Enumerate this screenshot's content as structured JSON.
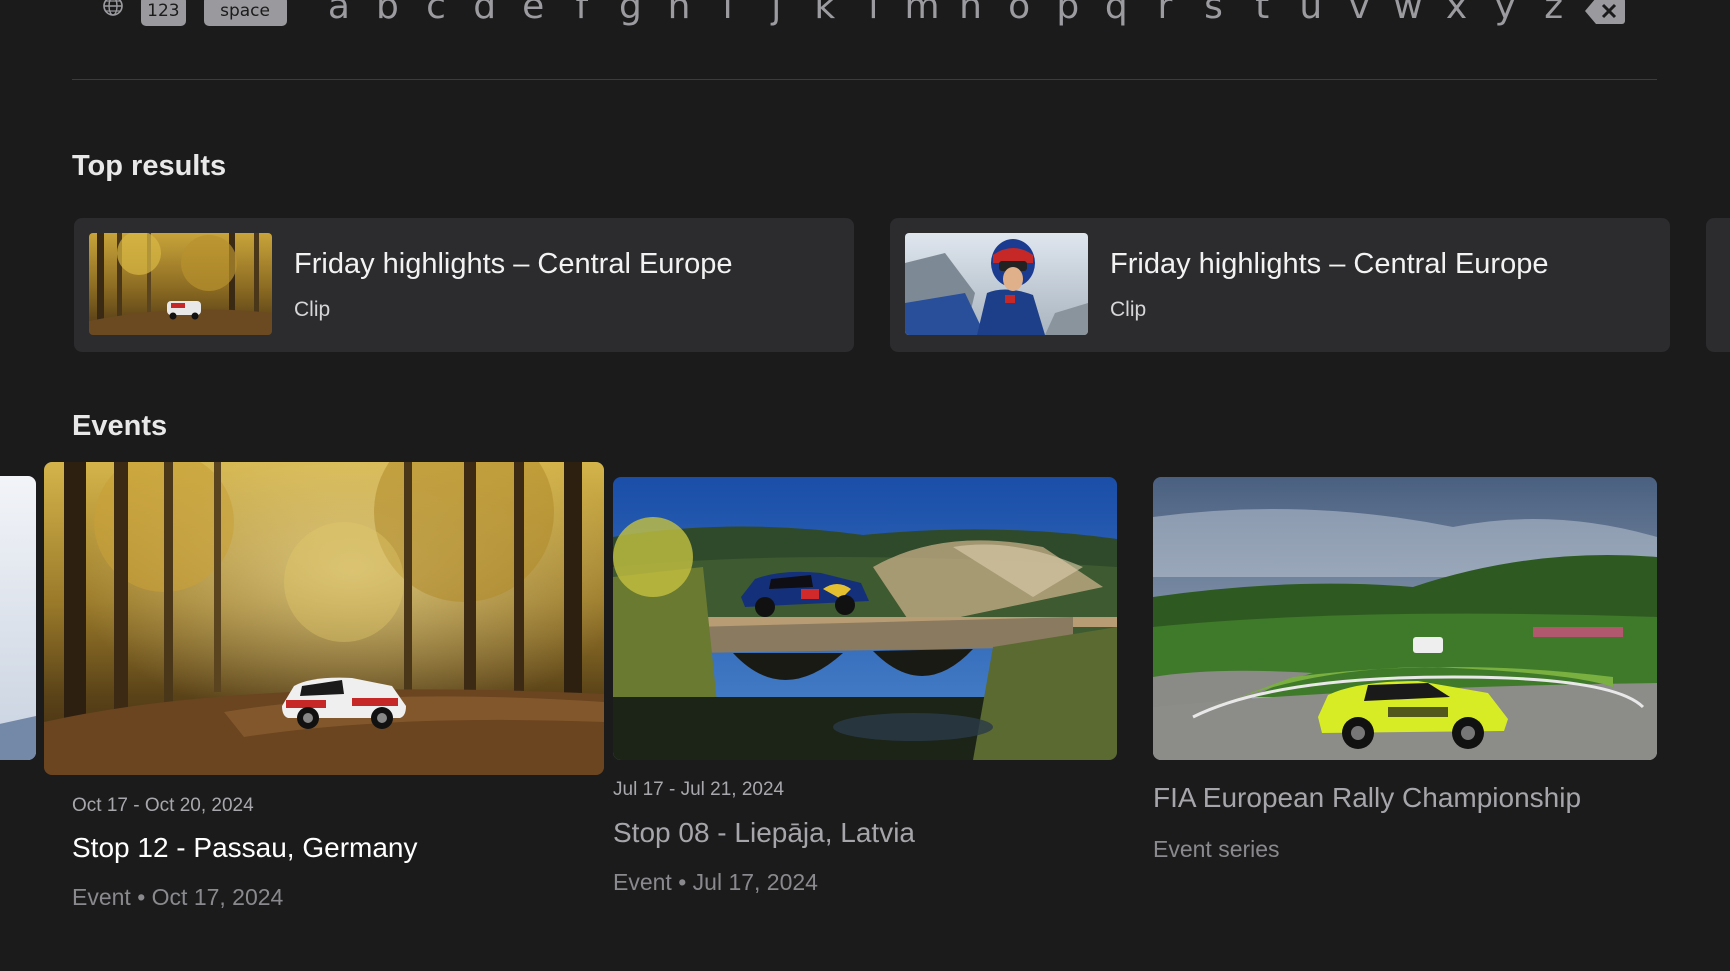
{
  "keyboard": {
    "numbers_key": "123",
    "space_key": "space",
    "letters": [
      "a",
      "b",
      "c",
      "d",
      "e",
      "f",
      "g",
      "h",
      "i",
      "j",
      "k",
      "l",
      "m",
      "n",
      "o",
      "p",
      "q",
      "r",
      "s",
      "t",
      "u",
      "v",
      "w",
      "x",
      "y",
      "z"
    ]
  },
  "top_results": {
    "title": "Top results",
    "items": [
      {
        "title": "Friday highlights – Central Europe",
        "type": "Clip"
      },
      {
        "title": "Friday highlights – Central Europe",
        "type": "Clip"
      }
    ]
  },
  "events": {
    "title": "Events",
    "items": [
      {
        "date": "Oct 17 - Oct 20, 2024",
        "title": "Stop 12 - Passau, Germany",
        "meta": "Event • Oct 17, 2024"
      },
      {
        "date": "Jul 17 - Jul 21, 2024",
        "title": "Stop 08 - Liepāja, Latvia",
        "meta": "Event • Jul 17, 2024"
      },
      {
        "title": "FIA European Rally Championship",
        "meta": "Event series"
      }
    ]
  },
  "colors": {
    "background": "#1b1b1c",
    "card": "#2c2c2e",
    "keyboard_pill": "#9a9a9e",
    "focused_text": "#ffffff",
    "dim_text": "#8a8a8e"
  }
}
